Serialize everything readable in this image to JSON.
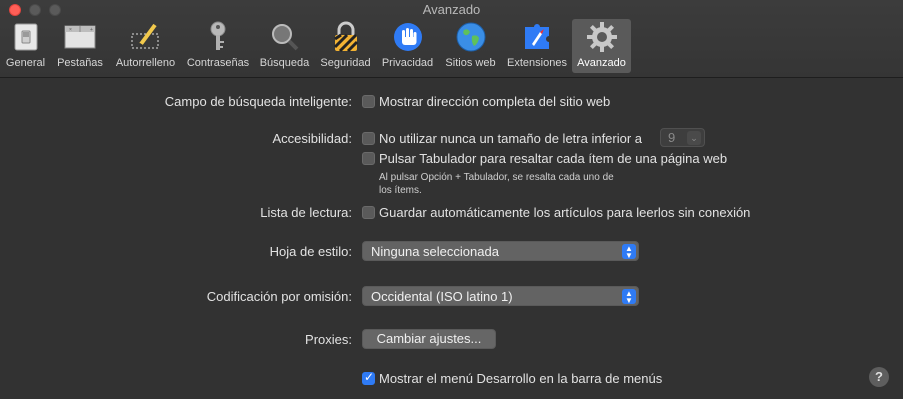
{
  "window": {
    "title": "Avanzado"
  },
  "toolbar": {
    "tabs": [
      {
        "label": "General",
        "icon": "switch-icon"
      },
      {
        "label": "Pestañas",
        "icon": "tabs-icon"
      },
      {
        "label": "Autorrelleno",
        "icon": "pencil-icon"
      },
      {
        "label": "Contraseñas",
        "icon": "key-icon"
      },
      {
        "label": "Búsqueda",
        "icon": "magnifier-icon"
      },
      {
        "label": "Seguridad",
        "icon": "lock-icon"
      },
      {
        "label": "Privacidad",
        "icon": "hand-icon"
      },
      {
        "label": "Sitios web",
        "icon": "globe-icon"
      },
      {
        "label": "Extensiones",
        "icon": "puzzle-icon"
      },
      {
        "label": "Avanzado",
        "icon": "gear-icon",
        "active": true
      }
    ]
  },
  "settings": {
    "smart_search": {
      "label": "Campo de búsqueda inteligente:",
      "option": "Mostrar dirección completa del sitio web",
      "checked": false
    },
    "accessibility": {
      "label": "Accesibilidad:",
      "font_option": "No utilizar nunca un tamaño de letra inferior a",
      "font_checked": false,
      "font_size_value": "9",
      "tab_option": "Pulsar Tabulador para resaltar cada ítem de una página web",
      "tab_checked": false,
      "tab_note_line1": "Al pulsar Opción + Tabulador, se resalta cada uno de",
      "tab_note_line2": "los ítems."
    },
    "reading_list": {
      "label": "Lista de lectura:",
      "option": "Guardar automáticamente los artículos para leerlos sin conexión",
      "checked": false
    },
    "style_sheet": {
      "label": "Hoja de estilo:",
      "value": "Ninguna seleccionada"
    },
    "encoding": {
      "label": "Codificación por omisión:",
      "value": "Occidental (ISO latino 1)"
    },
    "proxies": {
      "label": "Proxies:",
      "button": "Cambiar ajustes..."
    },
    "develop_menu": {
      "option": "Mostrar el menú Desarrollo en la barra de menús",
      "checked": true
    }
  },
  "help": {
    "label": "?"
  },
  "colors": {
    "accent": "#2f7bf5",
    "background": "#323232",
    "close": "#ff5f57"
  }
}
